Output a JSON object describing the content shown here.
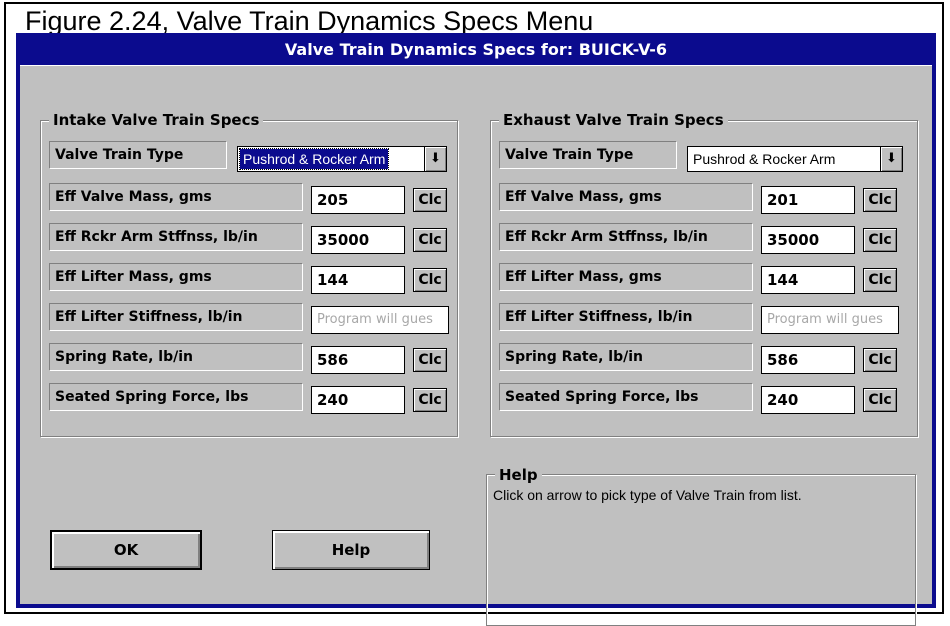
{
  "caption": "Figure 2.24, Valve Train Dynamics Specs Menu",
  "window": {
    "title": "Valve Train Dynamics Specs for: BUICK-V-6"
  },
  "intake": {
    "title": "Intake Valve Train Specs",
    "type_label": "Valve Train Type",
    "type_value": "Pushrod & Rocker Arm",
    "rows": [
      {
        "label": "Eff Valve Mass, gms",
        "value": "205",
        "button": "Clc"
      },
      {
        "label": "Eff Rckr Arm Stffnss, lb/in",
        "value": "35000",
        "button": "Clc"
      },
      {
        "label": "Eff Lifter Mass, gms",
        "value": "144",
        "button": "Clc"
      },
      {
        "label": "Eff Lifter Stiffness, lb/in",
        "placeholder": "Program will gues"
      },
      {
        "label": "Spring Rate, lb/in",
        "value": "586",
        "button": "Clc"
      },
      {
        "label": "Seated Spring Force, lbs",
        "value": "240",
        "button": "Clc"
      }
    ]
  },
  "exhaust": {
    "title": "Exhaust Valve Train Specs",
    "type_label": "Valve Train Type",
    "type_value": "Pushrod & Rocker Arm",
    "rows": [
      {
        "label": "Eff Valve Mass, gms",
        "value": "201",
        "button": "Clc"
      },
      {
        "label": "Eff Rckr Arm Stffnss, lb/in",
        "value": "35000",
        "button": "Clc"
      },
      {
        "label": "Eff Lifter Mass, gms",
        "value": "144",
        "button": "Clc"
      },
      {
        "label": "Eff Lifter Stiffness, lb/in",
        "placeholder": "Program will gues"
      },
      {
        "label": "Spring Rate, lb/in",
        "value": "586",
        "button": "Clc"
      },
      {
        "label": "Seated Spring Force, lbs",
        "value": "240",
        "button": "Clc"
      }
    ]
  },
  "buttons": {
    "ok": "OK",
    "help": "Help"
  },
  "help_panel": {
    "title": "Help",
    "text": "Click on arrow to pick type of Valve Train from list."
  },
  "icons": {
    "dropdown": "dropdown-arrow-icon"
  },
  "colors": {
    "titlebar": "#0b0b8e",
    "face": "#c0c0c0"
  }
}
